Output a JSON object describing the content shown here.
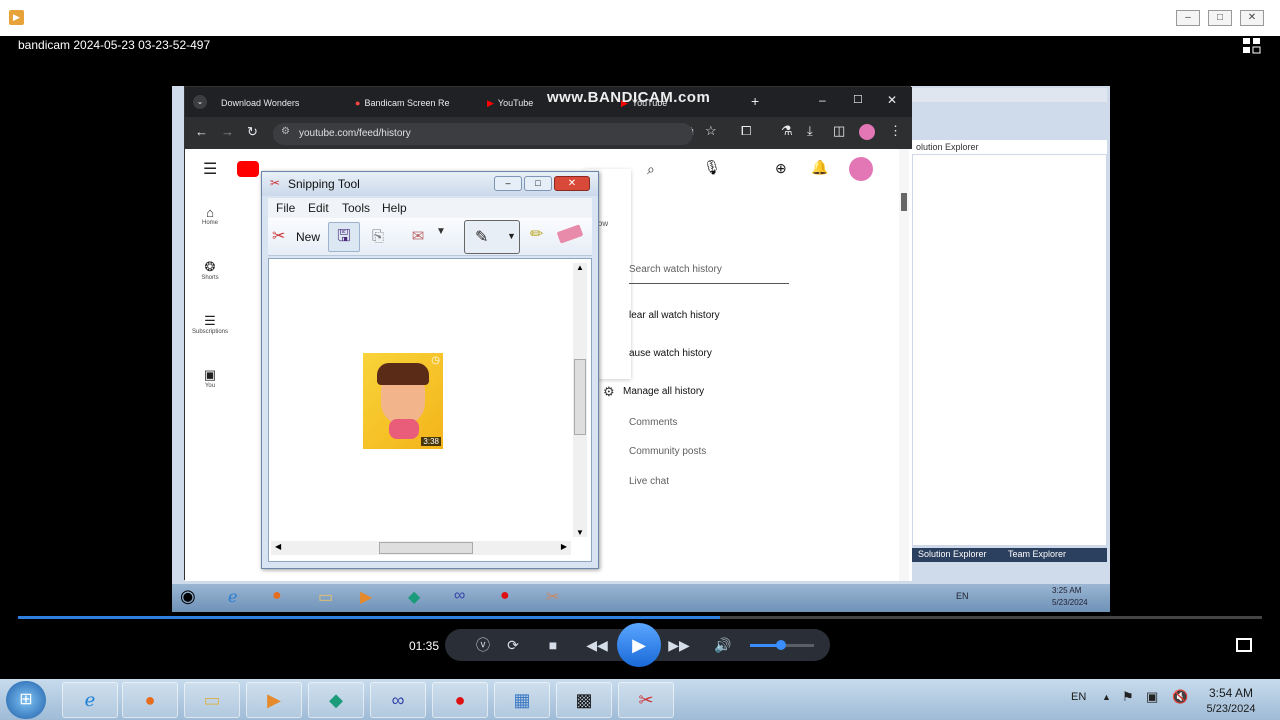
{
  "outer": {
    "title": "bandicam 2024-05-23 03-23-52-497",
    "minimize": "–",
    "maximize": "□",
    "close": "✕"
  },
  "chrome": {
    "tabs": [
      {
        "label": "Download Wonders"
      },
      {
        "label": "Bandicam Screen Re"
      },
      {
        "label": "YouTube"
      },
      {
        "label": "YouTube"
      }
    ],
    "watermark": "www.BANDICAM.com",
    "new_tab": "+",
    "url": "youtube.com/feed/history"
  },
  "youtube": {
    "sidebar": [
      {
        "label": "Home",
        "icon": "home-icon"
      },
      {
        "label": "Shorts",
        "icon": "shorts-icon"
      },
      {
        "label": "Subscriptions",
        "icon": "subscriptions-icon"
      },
      {
        "label": "You",
        "icon": "you-icon"
      }
    ],
    "search_history_placeholder": "Search watch history",
    "clear_history": "lear all watch history",
    "pause_history": "ause watch history",
    "manage_history": "Manage all history",
    "sub_items": [
      "Comments",
      "Community posts",
      "Live chat"
    ],
    "popup_text": "ndow"
  },
  "snipping_tool": {
    "title": "Snipping Tool",
    "menu": [
      "File",
      "Edit",
      "Tools",
      "Help"
    ],
    "new_label": "New",
    "thumb_duration": "3:38"
  },
  "vs": {
    "solution_explorer": "olution Explorer",
    "tab_solution": "Solution Explorer",
    "tab_team": "Team Explorer",
    "tray_lang": "EN",
    "tray_time": "3:25 AM",
    "tray_date": "5/23/2024"
  },
  "player": {
    "time": "01:35",
    "progress": 0.564
  },
  "taskbar": {
    "lang": "EN",
    "time": "3:54 AM",
    "date": "5/23/2024"
  }
}
